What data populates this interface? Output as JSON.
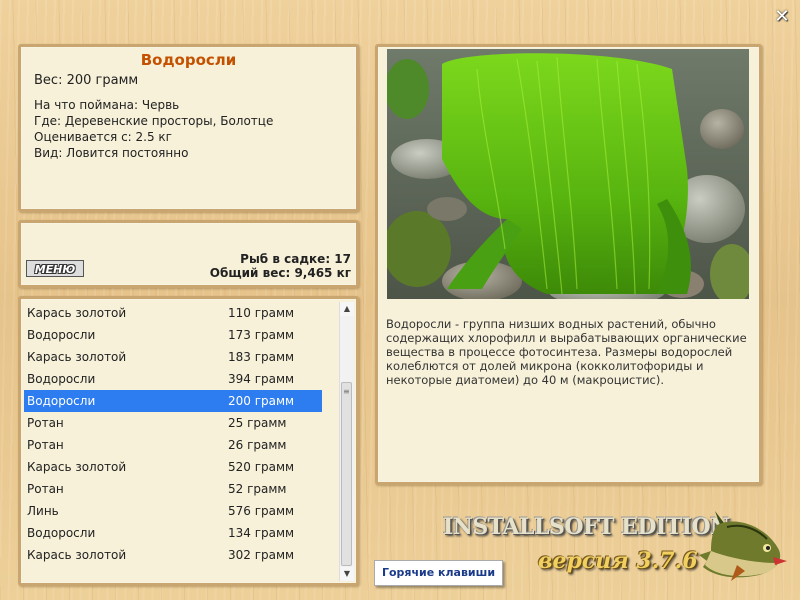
{
  "info": {
    "title": "Водоросли",
    "weight": "Вес: 200 грамм",
    "caught_on": "На что поймана: Червь",
    "where": "Где: Деревенские просторы, Болотце",
    "valued_from": "Оценивается с: 2.5 кг",
    "kind": "Вид: Ловится постоянно"
  },
  "stats": {
    "menu_label": "МЕНЮ",
    "fish_in_cage": "Рыб в садке: 17",
    "total_weight": "Общий вес: 9,465 кг"
  },
  "catch_list": [
    {
      "name": "Карась золотой",
      "weight": "110 грамм"
    },
    {
      "name": "Водоросли",
      "weight": "173 грамм"
    },
    {
      "name": "Карась золотой",
      "weight": "183 грамм"
    },
    {
      "name": "Водоросли",
      "weight": "394 грамм"
    },
    {
      "name": "Водоросли",
      "weight": "200 грамм",
      "selected": true
    },
    {
      "name": "Ротан",
      "weight": "25 грамм"
    },
    {
      "name": "Ротан",
      "weight": "26 грамм"
    },
    {
      "name": "Карась золотой",
      "weight": "520 грамм"
    },
    {
      "name": "Ротан",
      "weight": "52 грамм"
    },
    {
      "name": "Линь",
      "weight": "576 грамм"
    },
    {
      "name": "Водоросли",
      "weight": "134 грамм"
    },
    {
      "name": "Карась золотой",
      "weight": "302 грамм"
    }
  ],
  "description": "Водоросли - группа низших водных растений, обычно содержащих хлорофилл и вырабатывающих органические вещества в процессе фотосинтеза. Размеры водорослей колеблются от долей микрона (кокколитофориды и некоторые диатомеи) до 40 м (макроцистис).",
  "branding": {
    "edition": "INSTALLSOFT EDITION",
    "version": "версия 3.7.6"
  },
  "hotkeys_label": "Горячие клавиши",
  "close_icon": "close-icon",
  "colors": {
    "title": "#c45100",
    "selection": "#2d7cf0",
    "panel_bg": "#f7f1d9",
    "panel_border": "#c9a570"
  }
}
